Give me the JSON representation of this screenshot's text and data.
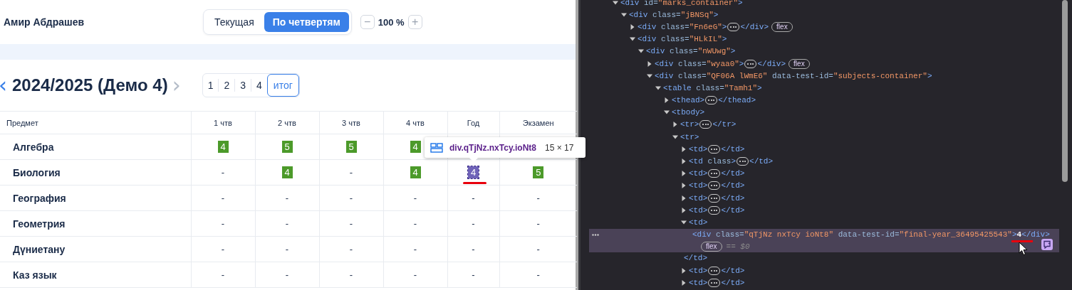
{
  "header": {
    "student": "Амир Абдрашев",
    "view_modes": [
      {
        "label": "Текущая",
        "selected": false
      },
      {
        "label": "По четвертям",
        "selected": true
      }
    ],
    "zoom": {
      "minus": "−",
      "value": "100 %",
      "plus": "+"
    }
  },
  "year": {
    "prev": "‹",
    "title": "2024/2025 (Демо 4)",
    "next": "›",
    "periods": [
      {
        "label": "1",
        "selected": false
      },
      {
        "label": "2",
        "selected": false
      },
      {
        "label": "3",
        "selected": false
      },
      {
        "label": "4",
        "selected": false
      },
      {
        "label": "итог",
        "selected": true
      }
    ]
  },
  "table": {
    "columns": [
      "Предмет",
      "1 чтв",
      "2 чтв",
      "3 чтв",
      "4 чтв",
      "Год",
      "Экзамен"
    ],
    "rows": [
      {
        "cells": [
          {
            "kind": "subject",
            "value": "Алгебра"
          },
          {
            "kind": "mark",
            "value": "4"
          },
          {
            "kind": "mark",
            "value": "5"
          },
          {
            "kind": "mark",
            "value": "5"
          },
          {
            "kind": "mark",
            "value": "4"
          },
          {
            "kind": "covered"
          },
          {
            "kind": "covered"
          }
        ]
      },
      {
        "cells": [
          {
            "kind": "subject",
            "value": "Биология"
          },
          {
            "kind": "dash",
            "value": "-"
          },
          {
            "kind": "mark",
            "value": "4"
          },
          {
            "kind": "dash",
            "value": "-"
          },
          {
            "kind": "mark",
            "value": "4"
          },
          {
            "kind": "inspected",
            "value": "4"
          },
          {
            "kind": "mark",
            "value": "5"
          }
        ]
      },
      {
        "cells": [
          {
            "kind": "subject",
            "value": "География"
          },
          {
            "kind": "dash",
            "value": "-"
          },
          {
            "kind": "dash",
            "value": "-"
          },
          {
            "kind": "dash",
            "value": "-"
          },
          {
            "kind": "dash",
            "value": "-"
          },
          {
            "kind": "dash",
            "value": "-"
          },
          {
            "kind": "dash",
            "value": "-"
          }
        ]
      },
      {
        "cells": [
          {
            "kind": "subject",
            "value": "Геометрия"
          },
          {
            "kind": "dash",
            "value": "-"
          },
          {
            "kind": "dash",
            "value": "-"
          },
          {
            "kind": "dash",
            "value": "-"
          },
          {
            "kind": "dash",
            "value": "-"
          },
          {
            "kind": "dash",
            "value": "-"
          },
          {
            "kind": "dash",
            "value": "-"
          }
        ]
      },
      {
        "cells": [
          {
            "kind": "subject",
            "value": "Дүниетану"
          },
          {
            "kind": "dash",
            "value": "-"
          },
          {
            "kind": "dash",
            "value": "-"
          },
          {
            "kind": "dash",
            "value": "-"
          },
          {
            "kind": "dash",
            "value": "-"
          },
          {
            "kind": "dash",
            "value": "-"
          },
          {
            "kind": "dash",
            "value": "-"
          }
        ]
      },
      {
        "cells": [
          {
            "kind": "subject",
            "value": "Каз язык"
          },
          {
            "kind": "dash",
            "value": "-"
          },
          {
            "kind": "dash",
            "value": "-"
          },
          {
            "kind": "dash",
            "value": "-"
          },
          {
            "kind": "dash",
            "value": "-"
          },
          {
            "kind": "dash",
            "value": "-"
          },
          {
            "kind": "dash",
            "value": "-"
          }
        ]
      }
    ]
  },
  "inspector_tooltip": {
    "selector": "div.qTjNz.nxTcy.ioNt8",
    "size": "15 × 17"
  },
  "devtools": {
    "elements": [
      {
        "open": "<div id=\"marks_container\">",
        "expanded": true,
        "selected": false,
        "children": [
          {
            "open": "<div class=\"jBNSq\">",
            "expanded": true,
            "selected": false,
            "children": [
              {
                "open": "<div class=\"Fn6eG\">",
                "close": "</div>",
                "badge": "flex",
                "expanded": false,
                "selected": false
              },
              {
                "open": "<div class=\"HLkIL\">",
                "expanded": true,
                "selected": false,
                "children": [
                  {
                    "open": "<div class=\"nWUwg\">",
                    "expanded": true,
                    "selected": false,
                    "children": [
                      {
                        "open": "<div class=\"wyaa0\">",
                        "close": "</div>",
                        "badge": "flex",
                        "expanded": false,
                        "selected": false
                      },
                      {
                        "open": "<div class=\"QF06A lWmE6\" data-test-id=\"subjects-container\">",
                        "expanded": true,
                        "selected": false,
                        "children": [
                          {
                            "open": "<table class=\"Tamh1\">",
                            "expanded": true,
                            "selected": false,
                            "children": [
                              {
                                "open": "<thead>",
                                "close": "</thead>",
                                "expanded": false,
                                "selected": false
                              },
                              {
                                "open": "<tbody>",
                                "expanded": true,
                                "selected": false,
                                "children": [
                                  {
                                    "open": "<tr>",
                                    "close": "</tr>",
                                    "expanded": false,
                                    "selected": false
                                  },
                                  {
                                    "open": "<tr>",
                                    "expanded": true,
                                    "selected": false,
                                    "children": [
                                      {
                                        "open": "<td>",
                                        "close": "</td>",
                                        "expanded": false,
                                        "selected": false
                                      },
                                      {
                                        "open": "<td class>",
                                        "close": "</td>",
                                        "expanded": false,
                                        "selected": false
                                      },
                                      {
                                        "open": "<td>",
                                        "close": "</td>",
                                        "expanded": false,
                                        "selected": false
                                      },
                                      {
                                        "open": "<td>",
                                        "close": "</td>",
                                        "expanded": false,
                                        "selected": false
                                      },
                                      {
                                        "open": "<td>",
                                        "close": "</td>",
                                        "expanded": false,
                                        "selected": false
                                      },
                                      {
                                        "open": "<td>",
                                        "close": "</td>",
                                        "expanded": false,
                                        "selected": false
                                      },
                                      {
                                        "open": "<td>",
                                        "close": "</td>",
                                        "expanded": true,
                                        "selected": false,
                                        "children": [
                                          {
                                            "open": "<div class=\"qTjNz nxTcy ioNt8\" data-test-id=\"final-year_36495425543\">4</div>",
                                            "badge": "flex",
                                            "console_ref": "== $0",
                                            "selected": true
                                          }
                                        ]
                                      },
                                      {
                                        "open": "<td>",
                                        "close": "</td>",
                                        "expanded": false,
                                        "selected": false
                                      },
                                      {
                                        "open": "<td>",
                                        "close": "</td>",
                                        "expanded": false,
                                        "selected": false
                                      }
                                    ]
                                  }
                                ]
                              }
                            ]
                          }
                        ]
                      }
                    ]
                  }
                ]
              }
            ]
          }
        ]
      }
    ]
  }
}
